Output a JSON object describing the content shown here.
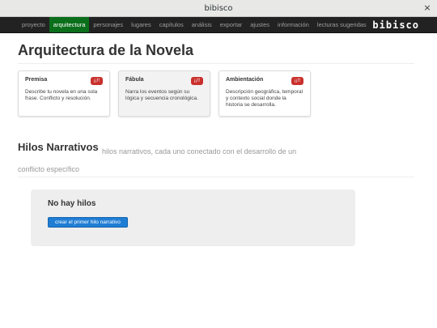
{
  "window": {
    "title": "bibisco",
    "close_icon": "×"
  },
  "nav": {
    "items": [
      {
        "label": "proyecto",
        "active": false
      },
      {
        "label": "arquitectura",
        "active": true
      },
      {
        "label": "personajes",
        "active": false
      },
      {
        "label": "lugares",
        "active": false
      },
      {
        "label": "capítulos",
        "active": false
      },
      {
        "label": "análisis",
        "active": false
      },
      {
        "label": "exportar",
        "active": false
      },
      {
        "label": "ajustes",
        "active": false
      },
      {
        "label": "información",
        "active": false
      },
      {
        "label": "lecturas sugeridas",
        "active": false
      }
    ],
    "brand": "bibisco",
    "active_color": "#0a6e1a"
  },
  "main": {
    "title": "Arquitectura de la Novela",
    "cards": [
      {
        "title": "Premisa",
        "badge": "¡¡!!",
        "body": "Describe tu novela en una sola frase. Conflicto y resolución."
      },
      {
        "title": "Fábula",
        "badge": "¡¡!!",
        "body": "Narra los eventos según su lógica y secuencia cronológica."
      },
      {
        "title": "Ambientación",
        "badge": "¡¡!!",
        "body": "Descripción geográfica, temporal y contexto social donde la historia se desarrolla."
      }
    ],
    "threads": {
      "title": "Hilos Narrativos",
      "subtitle": "hilos narrativos, cada uno conectado con el desarrollo de un conflicto específico",
      "empty_title": "No hay hilos",
      "create_button": "crear el primer hilo narrativo"
    }
  },
  "colors": {
    "badge": "#c9302c",
    "primary_button": "#1f7dd4",
    "navbar": "#222222"
  }
}
